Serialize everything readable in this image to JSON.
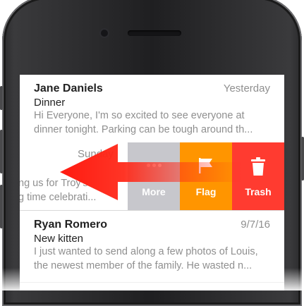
{
  "emails": [
    {
      "sender": "Jane Daniels",
      "date": "Yesterday",
      "subject": "Dinner",
      "preview": "Hi Everyone, I'm so excited to see everyone at dinner tonight. Parking can be tough around th..."
    },
    {
      "sender": "Ryan Romero",
      "date": "9/7/16",
      "subject": "New kitten",
      "preview": "I just wanted to send along a few photos of Louis, the newest member of the family. He wasted n..."
    }
  ],
  "swiped_row": {
    "date": "Sunday",
    "snippet_line1": "ng us for Troy's",
    "snippet_line2": "g time celebrati..."
  },
  "actions": {
    "more_label": "More",
    "flag_label": "Flag",
    "trash_label": "Trash",
    "more_color": "#c7c7cc",
    "flag_color": "#ff9500",
    "trash_color": "#ff3b30",
    "more_icon": "ellipsis-icon",
    "flag_icon": "flag-icon",
    "trash_icon": "trash-icon"
  },
  "gesture": {
    "direction": "left",
    "arrow_color": "#ff2a1a",
    "arrow_icon": "swipe-left-arrow-icon"
  }
}
